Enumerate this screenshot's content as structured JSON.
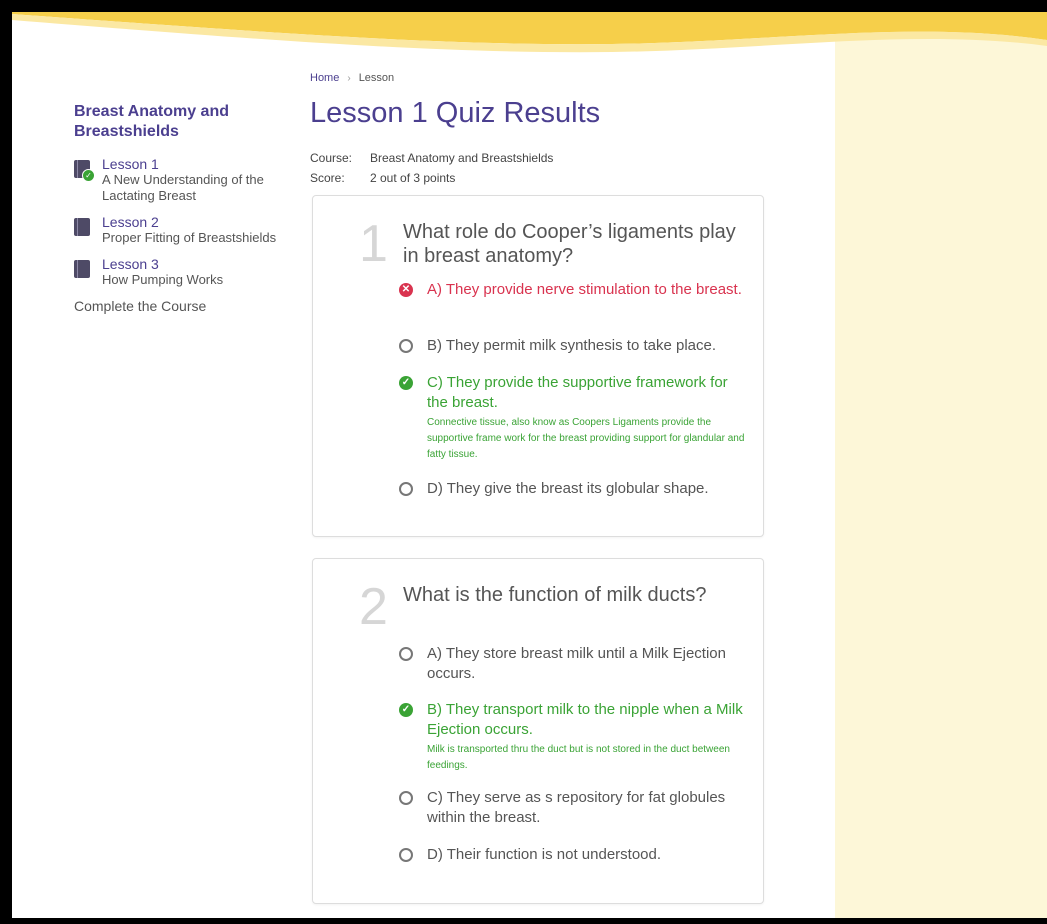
{
  "breadcrumb": {
    "home": "Home",
    "separator": "›",
    "current": "Lesson"
  },
  "sidebar": {
    "course_title": "Breast Anatomy and Breastshields",
    "lessons": [
      {
        "number": "Lesson 1",
        "title": "A New Understanding of the Lactating Breast",
        "completed": true
      },
      {
        "number": "Lesson 2",
        "title": "Proper Fitting of Breastshields",
        "completed": false
      },
      {
        "number": "Lesson 3",
        "title": "How Pumping Works",
        "completed": false
      }
    ],
    "complete_link": "Complete the Course"
  },
  "main": {
    "title": "Lesson 1 Quiz Results",
    "course_label": "Course:",
    "course_value": "Breast Anatomy and Breastshields",
    "score_label": "Score:",
    "score_value": "2 out of 3 points"
  },
  "questions": [
    {
      "number": "1",
      "text": "What role do Cooper’s ligaments play in breast anatomy?",
      "answers": [
        {
          "label": "A) They provide nerve stimulation to the breast.",
          "state": "wrong"
        },
        {
          "label": "B) They permit milk synthesis to take place.",
          "state": "unselected"
        },
        {
          "label": "C) They provide the supportive framework for the breast.",
          "state": "correct",
          "explanation": "Connective tissue, also know as Coopers Ligaments provide the supportive frame work for the breast providing support for glandular and fatty tissue."
        },
        {
          "label": "D) They give the breast its globular shape.",
          "state": "unselected"
        }
      ]
    },
    {
      "number": "2",
      "text": "What is the function of milk ducts?",
      "answers": [
        {
          "label": "A) They store breast milk until a Milk Ejection occurs.",
          "state": "unselected"
        },
        {
          "label": "B) They transport milk to the nipple when a Milk Ejection occurs.",
          "state": "correct",
          "explanation": "Milk is transported thru the duct but is not stored in the duct between feedings."
        },
        {
          "label": "C) They serve as s repository for fat globules within the breast.",
          "state": "unselected"
        },
        {
          "label": "D) Their function is not understood.",
          "state": "unselected"
        }
      ]
    }
  ],
  "colors": {
    "accent": "#4b3f8f",
    "wrong": "#d9334f",
    "correct": "#3aa335",
    "cream": "#fdf7d8",
    "swoosh": "#f6cf4a"
  }
}
